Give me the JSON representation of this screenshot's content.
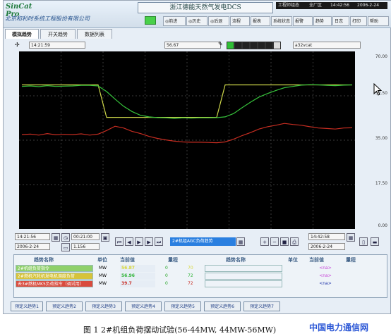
{
  "app": {
    "logo_text": "SinCat Pro",
    "company": "北京和利时系统工程股份有限公司",
    "title": "浙江德能天然气发电DCS",
    "status": [
      "工程师组态",
      "全厂区",
      "14:42:56",
      "2006-2-24"
    ],
    "nav_buttons": [
      "前进",
      "历史",
      "后退",
      "流程",
      "报表",
      "系统状态",
      "报警",
      "趋势",
      "日志",
      "打印",
      "帮助"
    ]
  },
  "tabs": [
    "模拟趋势",
    "开关趋势",
    "数据列表"
  ],
  "toolbar": {
    "cursor_time": "14:21:59",
    "cursor_value": "56.67",
    "point_name": "a32vcat"
  },
  "chart_data": {
    "type": "line",
    "ylim": [
      0,
      70
    ],
    "yticks": [
      "70.00",
      "52.50",
      "35.00",
      "17.50",
      "0.00"
    ],
    "series": [
      {
        "color": "#cfd84a",
        "values": [
          56.8,
          56.8,
          56.8,
          56.8,
          56.8,
          56.8,
          56.8,
          56.8,
          56.8,
          56.8,
          44.0,
          44.0,
          44.0,
          44.0,
          44.0,
          44.0,
          44.0,
          44.0,
          44.0,
          44.0,
          44.0,
          44.0,
          44.0,
          44.0,
          56.8,
          56.8,
          56.8,
          56.8,
          56.8,
          56.8,
          56.8,
          56.8,
          56.8,
          56.8,
          56.8,
          56.8,
          56.8,
          56.8,
          56.8,
          56.8
        ]
      },
      {
        "color": "#36c23b",
        "values": [
          56.2,
          56.4,
          56.1,
          56.5,
          56.2,
          56.3,
          56.4,
          56.6,
          56.6,
          56.4,
          54.2,
          51.2,
          48.4,
          46.3,
          44.8,
          44.2,
          43.9,
          43.8,
          43.6,
          43.8,
          43.7,
          43.8,
          43.8,
          43.9,
          44.2,
          45.5,
          47.8,
          50.0,
          52.0,
          53.4,
          54.6,
          55.7,
          56.2,
          56.7,
          56.9,
          56.8,
          56.6,
          56.5,
          56.7,
          56.8
        ]
      },
      {
        "color": "#c62d21",
        "values": [
          37.2,
          37.4,
          37.0,
          37.6,
          37.1,
          37.3,
          37.2,
          37.5,
          37.0,
          37.4,
          38.8,
          40.5,
          39.8,
          38.5,
          37.6,
          36.5,
          35.7,
          35.1,
          34.6,
          34.3,
          34.2,
          34.2,
          34.1,
          34.0,
          34.3,
          35.4,
          36.8,
          38.0,
          39.4,
          40.3,
          40.9,
          41.6,
          41.2,
          40.9,
          40.3,
          39.8,
          39.6,
          39.4,
          39.8,
          39.9
        ]
      }
    ]
  },
  "controls": {
    "start_time": "14:21:56",
    "span": "00:21:00",
    "date_left": "2006-2-24",
    "scale": "1.156",
    "group_name": "2#机组AGC负荷趋势",
    "end_time": "14:42:58",
    "date_right": "2006-2-24"
  },
  "table": {
    "headers": [
      "趋势名称",
      "单位",
      "当前值",
      "量程",
      "趋势名称",
      "单位",
      "当前值",
      "量程"
    ],
    "rows": [
      {
        "name": "2#机组负荷指令",
        "unit": "MW",
        "value": "56.87",
        "min": "0",
        "max": "70",
        "bg": "#eef3f8",
        "color": "#d8d83a"
      },
      {
        "name": "2#燃机汽轮机发电机调度负荷",
        "unit": "MW",
        "value": "56.96",
        "min": "0",
        "max": "72",
        "bg": "#eef3f8",
        "color": "#31b53a"
      },
      {
        "name": "去3#燃机MK5负荷指令（调试用）",
        "unit": "MW",
        "value": "39.7",
        "min": "0",
        "max": "72",
        "bg": "#eef3f8",
        "color": "#c9322a"
      }
    ],
    "right_values": [
      "<na>",
      "<na>",
      "<na>"
    ],
    "right_value_colors": [
      "#c43ad6",
      "#c43ad6",
      "#1a2fa8"
    ]
  },
  "bottom_tabs": [
    "预定义趋势1",
    "预定义趋势2",
    "预定义趋势3",
    "预定义趋势4",
    "预定义趋势5",
    "预定义趋势6",
    "预定义趋势7"
  ],
  "footer": {
    "caption": "图 1   2#机组负荷摆动试验(56-44MW, 44MW-56MW)",
    "watermark": "中国电力通信网"
  }
}
